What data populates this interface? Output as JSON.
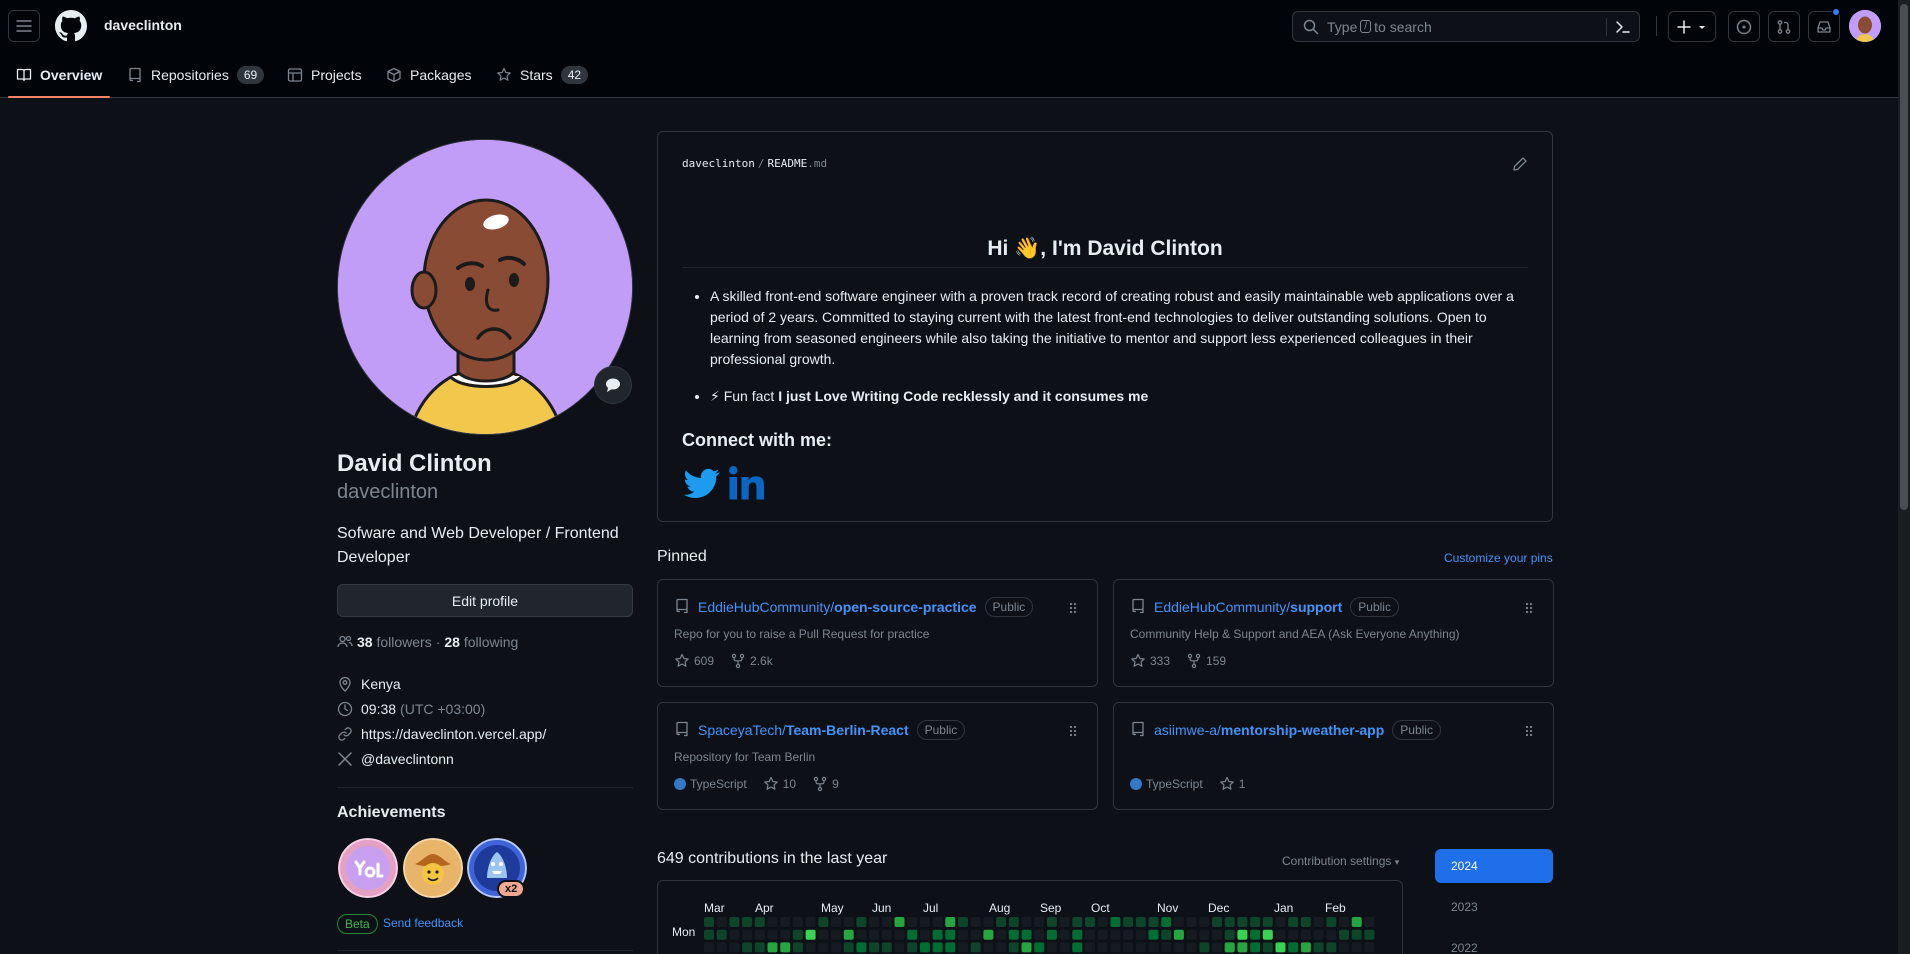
{
  "header": {
    "username": "daveclinton",
    "search_prefix": "Type",
    "search_key": "/",
    "search_suffix": "to search"
  },
  "tabs": [
    {
      "label": "Overview"
    },
    {
      "label": "Repositories",
      "count": "69"
    },
    {
      "label": "Projects"
    },
    {
      "label": "Packages"
    },
    {
      "label": "Stars",
      "count": "42"
    }
  ],
  "profile": {
    "name": "David Clinton",
    "login": "daveclinton",
    "bio": "Sofware and Web Developer / Frontend Developer",
    "edit_label": "Edit profile",
    "followers_count": "38",
    "followers_label": "followers",
    "dot": "·",
    "following_count": "28",
    "following_label": "following",
    "location": "Kenya",
    "time": "09:38",
    "timezone": "(UTC +03:00)",
    "website": "https://daveclinton.vercel.app/",
    "twitter": "@daveclintonn"
  },
  "achievements": {
    "title": "Achievements",
    "multiplier": "x2",
    "beta": "Beta",
    "feedback": "Send feedback"
  },
  "readme": {
    "path_user": "daveclinton",
    "path_sep": "/",
    "path_file": "README",
    "path_ext": ".md",
    "heading": "Hi 👋, I'm David Clinton",
    "bullet1": "A skilled front-end software engineer with a proven track record of creating robust and easily maintainable web applications over a period of 2 years. Committed to staying current with the latest front-end technologies to deliver outstanding solutions. Open to learning from seasoned engineers while also taking the initiative to mentor and support less experienced colleagues in their professional growth.",
    "bullet2_prefix": "⚡ Fun fact",
    "bullet2_bold": "I just Love Writing Code recklessly and it consumes me",
    "connect": "Connect with me:"
  },
  "pinned": {
    "title": "Pinned",
    "customize": "Customize your pins",
    "repos": [
      {
        "owner": "EddieHubCommunity/",
        "name": "open-source-practice",
        "visibility": "Public",
        "desc": "Repo for you to raise a Pull Request for practice",
        "language": "",
        "stars": "609",
        "forks": "2.6k"
      },
      {
        "owner": "EddieHubCommunity/",
        "name": "support",
        "visibility": "Public",
        "desc": "Community Help & Support and AEA (Ask Everyone Anything)",
        "language": "",
        "stars": "333",
        "forks": "159"
      },
      {
        "owner": "SpaceyaTech/",
        "name": "Team-Berlin-React",
        "visibility": "Public",
        "desc": "Repository for Team Berlin",
        "language": "TypeScript",
        "stars": "10",
        "forks": "9"
      },
      {
        "owner": "asiimwe-a/",
        "name": "mentorship-weather-app",
        "visibility": "Public",
        "desc": "",
        "language": "TypeScript",
        "stars": "1",
        "forks": ""
      }
    ]
  },
  "contributions": {
    "title": "649 contributions in the last year",
    "settings": "Contribution settings",
    "months": [
      "Mar",
      "Apr",
      "May",
      "Jun",
      "Jul",
      "Aug",
      "Sep",
      "Oct",
      "Nov",
      "Dec",
      "Jan",
      "Feb"
    ],
    "day_label": "Mon",
    "years": [
      "2024",
      "2023",
      "2022"
    ]
  },
  "colors": {
    "accent": "#4493f8",
    "tab_underline": "#f78166",
    "active_year": "#1f6feb",
    "avatar_bg": "#c29df8",
    "contrib_levels": [
      "#161b22",
      "#0e4429",
      "#006d32",
      "#26a641",
      "#39d353"
    ]
  }
}
